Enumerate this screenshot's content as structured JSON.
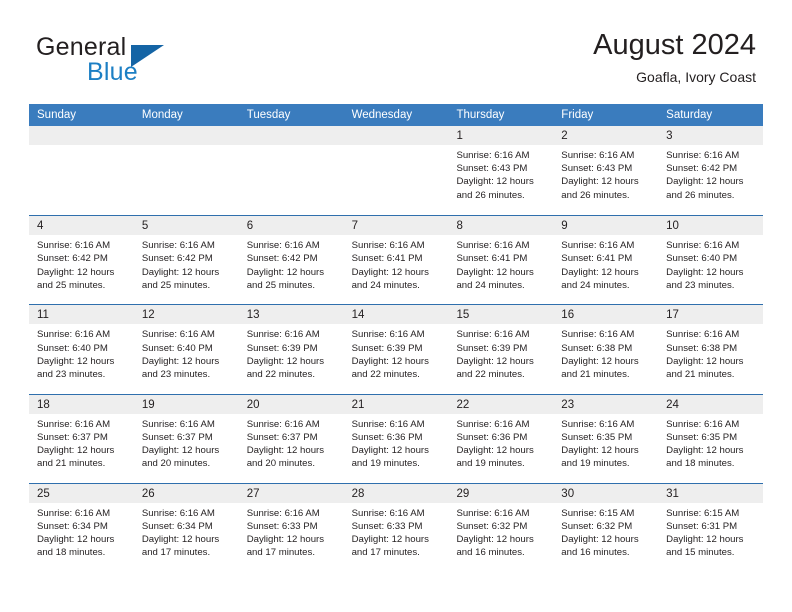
{
  "brand": {
    "word1": "General",
    "word2": "Blue",
    "logo_icon": "triangle-logo-icon",
    "blue": "#1c7fc4",
    "dark_blue": "#1464a5"
  },
  "header": {
    "title": "August 2024",
    "subtitle": "Goafla, Ivory Coast"
  },
  "calendar": {
    "header_color": "#3a7cbe",
    "weekdays": [
      "Sunday",
      "Monday",
      "Tuesday",
      "Wednesday",
      "Thursday",
      "Friday",
      "Saturday"
    ],
    "weeks": [
      [
        {
          "day": "",
          "empty": true,
          "sunrise": "",
          "sunset": "",
          "daylight1": "",
          "daylight2": ""
        },
        {
          "day": "",
          "empty": true,
          "sunrise": "",
          "sunset": "",
          "daylight1": "",
          "daylight2": ""
        },
        {
          "day": "",
          "empty": true,
          "sunrise": "",
          "sunset": "",
          "daylight1": "",
          "daylight2": ""
        },
        {
          "day": "",
          "empty": true,
          "sunrise": "",
          "sunset": "",
          "daylight1": "",
          "daylight2": ""
        },
        {
          "day": "1",
          "empty": false,
          "sunrise": "Sunrise: 6:16 AM",
          "sunset": "Sunset: 6:43 PM",
          "daylight1": "Daylight: 12 hours",
          "daylight2": "and 26 minutes."
        },
        {
          "day": "2",
          "empty": false,
          "sunrise": "Sunrise: 6:16 AM",
          "sunset": "Sunset: 6:43 PM",
          "daylight1": "Daylight: 12 hours",
          "daylight2": "and 26 minutes."
        },
        {
          "day": "3",
          "empty": false,
          "sunrise": "Sunrise: 6:16 AM",
          "sunset": "Sunset: 6:42 PM",
          "daylight1": "Daylight: 12 hours",
          "daylight2": "and 26 minutes."
        }
      ],
      [
        {
          "day": "4",
          "empty": false,
          "sunrise": "Sunrise: 6:16 AM",
          "sunset": "Sunset: 6:42 PM",
          "daylight1": "Daylight: 12 hours",
          "daylight2": "and 25 minutes."
        },
        {
          "day": "5",
          "empty": false,
          "sunrise": "Sunrise: 6:16 AM",
          "sunset": "Sunset: 6:42 PM",
          "daylight1": "Daylight: 12 hours",
          "daylight2": "and 25 minutes."
        },
        {
          "day": "6",
          "empty": false,
          "sunrise": "Sunrise: 6:16 AM",
          "sunset": "Sunset: 6:42 PM",
          "daylight1": "Daylight: 12 hours",
          "daylight2": "and 25 minutes."
        },
        {
          "day": "7",
          "empty": false,
          "sunrise": "Sunrise: 6:16 AM",
          "sunset": "Sunset: 6:41 PM",
          "daylight1": "Daylight: 12 hours",
          "daylight2": "and 24 minutes."
        },
        {
          "day": "8",
          "empty": false,
          "sunrise": "Sunrise: 6:16 AM",
          "sunset": "Sunset: 6:41 PM",
          "daylight1": "Daylight: 12 hours",
          "daylight2": "and 24 minutes."
        },
        {
          "day": "9",
          "empty": false,
          "sunrise": "Sunrise: 6:16 AM",
          "sunset": "Sunset: 6:41 PM",
          "daylight1": "Daylight: 12 hours",
          "daylight2": "and 24 minutes."
        },
        {
          "day": "10",
          "empty": false,
          "sunrise": "Sunrise: 6:16 AM",
          "sunset": "Sunset: 6:40 PM",
          "daylight1": "Daylight: 12 hours",
          "daylight2": "and 23 minutes."
        }
      ],
      [
        {
          "day": "11",
          "empty": false,
          "sunrise": "Sunrise: 6:16 AM",
          "sunset": "Sunset: 6:40 PM",
          "daylight1": "Daylight: 12 hours",
          "daylight2": "and 23 minutes."
        },
        {
          "day": "12",
          "empty": false,
          "sunrise": "Sunrise: 6:16 AM",
          "sunset": "Sunset: 6:40 PM",
          "daylight1": "Daylight: 12 hours",
          "daylight2": "and 23 minutes."
        },
        {
          "day": "13",
          "empty": false,
          "sunrise": "Sunrise: 6:16 AM",
          "sunset": "Sunset: 6:39 PM",
          "daylight1": "Daylight: 12 hours",
          "daylight2": "and 22 minutes."
        },
        {
          "day": "14",
          "empty": false,
          "sunrise": "Sunrise: 6:16 AM",
          "sunset": "Sunset: 6:39 PM",
          "daylight1": "Daylight: 12 hours",
          "daylight2": "and 22 minutes."
        },
        {
          "day": "15",
          "empty": false,
          "sunrise": "Sunrise: 6:16 AM",
          "sunset": "Sunset: 6:39 PM",
          "daylight1": "Daylight: 12 hours",
          "daylight2": "and 22 minutes."
        },
        {
          "day": "16",
          "empty": false,
          "sunrise": "Sunrise: 6:16 AM",
          "sunset": "Sunset: 6:38 PM",
          "daylight1": "Daylight: 12 hours",
          "daylight2": "and 21 minutes."
        },
        {
          "day": "17",
          "empty": false,
          "sunrise": "Sunrise: 6:16 AM",
          "sunset": "Sunset: 6:38 PM",
          "daylight1": "Daylight: 12 hours",
          "daylight2": "and 21 minutes."
        }
      ],
      [
        {
          "day": "18",
          "empty": false,
          "sunrise": "Sunrise: 6:16 AM",
          "sunset": "Sunset: 6:37 PM",
          "daylight1": "Daylight: 12 hours",
          "daylight2": "and 21 minutes."
        },
        {
          "day": "19",
          "empty": false,
          "sunrise": "Sunrise: 6:16 AM",
          "sunset": "Sunset: 6:37 PM",
          "daylight1": "Daylight: 12 hours",
          "daylight2": "and 20 minutes."
        },
        {
          "day": "20",
          "empty": false,
          "sunrise": "Sunrise: 6:16 AM",
          "sunset": "Sunset: 6:37 PM",
          "daylight1": "Daylight: 12 hours",
          "daylight2": "and 20 minutes."
        },
        {
          "day": "21",
          "empty": false,
          "sunrise": "Sunrise: 6:16 AM",
          "sunset": "Sunset: 6:36 PM",
          "daylight1": "Daylight: 12 hours",
          "daylight2": "and 19 minutes."
        },
        {
          "day": "22",
          "empty": false,
          "sunrise": "Sunrise: 6:16 AM",
          "sunset": "Sunset: 6:36 PM",
          "daylight1": "Daylight: 12 hours",
          "daylight2": "and 19 minutes."
        },
        {
          "day": "23",
          "empty": false,
          "sunrise": "Sunrise: 6:16 AM",
          "sunset": "Sunset: 6:35 PM",
          "daylight1": "Daylight: 12 hours",
          "daylight2": "and 19 minutes."
        },
        {
          "day": "24",
          "empty": false,
          "sunrise": "Sunrise: 6:16 AM",
          "sunset": "Sunset: 6:35 PM",
          "daylight1": "Daylight: 12 hours",
          "daylight2": "and 18 minutes."
        }
      ],
      [
        {
          "day": "25",
          "empty": false,
          "sunrise": "Sunrise: 6:16 AM",
          "sunset": "Sunset: 6:34 PM",
          "daylight1": "Daylight: 12 hours",
          "daylight2": "and 18 minutes."
        },
        {
          "day": "26",
          "empty": false,
          "sunrise": "Sunrise: 6:16 AM",
          "sunset": "Sunset: 6:34 PM",
          "daylight1": "Daylight: 12 hours",
          "daylight2": "and 17 minutes."
        },
        {
          "day": "27",
          "empty": false,
          "sunrise": "Sunrise: 6:16 AM",
          "sunset": "Sunset: 6:33 PM",
          "daylight1": "Daylight: 12 hours",
          "daylight2": "and 17 minutes."
        },
        {
          "day": "28",
          "empty": false,
          "sunrise": "Sunrise: 6:16 AM",
          "sunset": "Sunset: 6:33 PM",
          "daylight1": "Daylight: 12 hours",
          "daylight2": "and 17 minutes."
        },
        {
          "day": "29",
          "empty": false,
          "sunrise": "Sunrise: 6:16 AM",
          "sunset": "Sunset: 6:32 PM",
          "daylight1": "Daylight: 12 hours",
          "daylight2": "and 16 minutes."
        },
        {
          "day": "30",
          "empty": false,
          "sunrise": "Sunrise: 6:15 AM",
          "sunset": "Sunset: 6:32 PM",
          "daylight1": "Daylight: 12 hours",
          "daylight2": "and 16 minutes."
        },
        {
          "day": "31",
          "empty": false,
          "sunrise": "Sunrise: 6:15 AM",
          "sunset": "Sunset: 6:31 PM",
          "daylight1": "Daylight: 12 hours",
          "daylight2": "and 15 minutes."
        }
      ]
    ]
  }
}
